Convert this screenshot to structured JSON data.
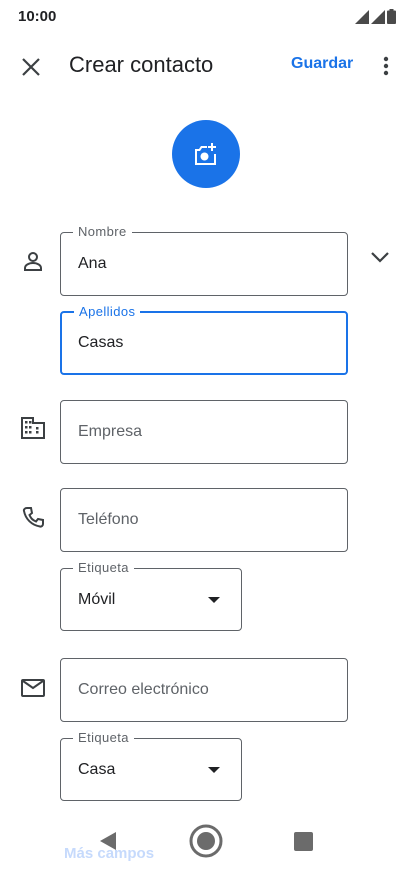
{
  "status_bar": {
    "time": "10:00"
  },
  "app_bar": {
    "title": "Crear contacto",
    "save_label": "Guardar"
  },
  "form": {
    "first_name": {
      "label": "Nombre",
      "value": "Ana"
    },
    "last_name": {
      "label": "Apellidos",
      "value": "Casas"
    },
    "company": {
      "placeholder": "Empresa"
    },
    "phone": {
      "placeholder": "Teléfono"
    },
    "phone_label": {
      "label": "Etiqueta",
      "value": "Móvil"
    },
    "email": {
      "placeholder": "Correo electrónico"
    },
    "email_label": {
      "label": "Etiqueta",
      "value": "Casa"
    }
  },
  "more_fields_label": "Más campos",
  "colors": {
    "accent": "#1a73e8",
    "text": "#202124",
    "secondary_text": "#5f6368",
    "outline": "#5f6368"
  },
  "icons": [
    "close-icon",
    "more-vert-icon",
    "add-photo-icon",
    "person-icon",
    "chevron-down-icon",
    "business-icon",
    "phone-icon",
    "email-icon",
    "dropdown-arrow-icon",
    "nav-back-icon",
    "nav-home-icon",
    "nav-recents-icon"
  ]
}
